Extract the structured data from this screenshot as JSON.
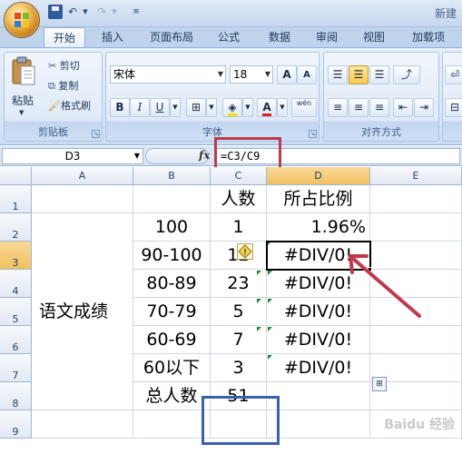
{
  "window": {
    "title": "新建"
  },
  "tabs": [
    "开始",
    "插入",
    "页面布局",
    "公式",
    "数据",
    "审阅",
    "视图",
    "加载项"
  ],
  "clipboard": {
    "paste": "粘贴",
    "cut": "剪切",
    "copy": "复制",
    "format_painter": "格式刷",
    "label": "剪贴板"
  },
  "font": {
    "name": "宋体",
    "size": "18",
    "label": "字体",
    "bold": "B",
    "italic": "I",
    "underline": "U",
    "grow": "A",
    "shrink": "A",
    "font_color": "A",
    "phonetic": "wén"
  },
  "alignment": {
    "label": "对齐方式"
  },
  "formula_bar": {
    "name_box": "D3",
    "fx": "fx",
    "formula": "=C3/C9"
  },
  "columns": [
    "A",
    "B",
    "C",
    "D",
    "E"
  ],
  "rows": [
    "1",
    "2",
    "3",
    "4",
    "5",
    "6",
    "7",
    "8",
    "9"
  ],
  "cells": {
    "A_merged": "语文成绩",
    "C1": "人数",
    "D1": "所占比例",
    "B2": "100",
    "C2": "1",
    "D2": "1.96%",
    "B3": "90-100",
    "C3": "12",
    "D3": "#DIV/0!",
    "B4": "80-89",
    "C4": "23",
    "D4": "#DIV/0!",
    "B5": "70-79",
    "C5": "5",
    "D5": "#DIV/0!",
    "B6": "60-69",
    "C6": "7",
    "D6": "#DIV/0!",
    "B7": "60以下",
    "C7": "3",
    "D7": "#DIV/0!",
    "B8": "总人数",
    "C8": "51"
  },
  "watermark": "Baidu 经验",
  "colors": {
    "selected_header": "#f1c15e",
    "annotation_red": "#c0394a",
    "annotation_blue": "#3a5fb4",
    "error_triangle": "#1a8a2e"
  }
}
